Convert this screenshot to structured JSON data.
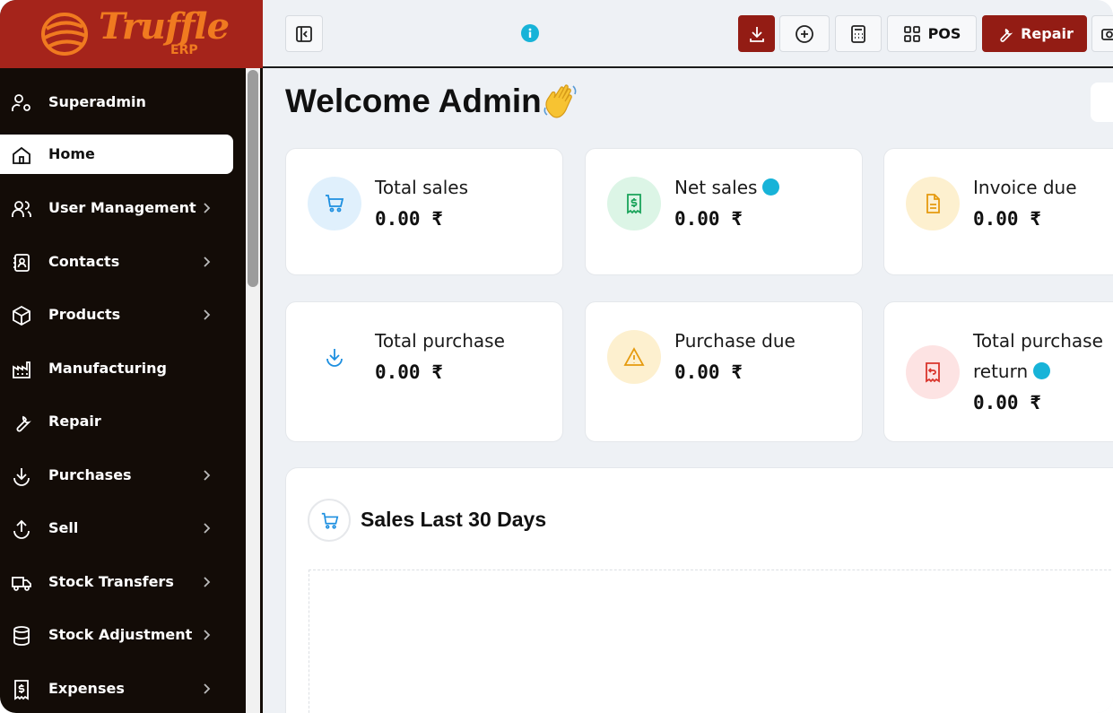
{
  "brand": {
    "name": "Truffle",
    "sub": "ERP",
    "logo_color": "#f07a20",
    "bar_color": "#a5241b"
  },
  "sidebar": {
    "items": [
      {
        "label": "Superadmin",
        "icon": "user-cog-icon",
        "has_children": false,
        "active": false
      },
      {
        "label": "Home",
        "icon": "home-icon",
        "has_children": false,
        "active": true
      },
      {
        "label": "User Management",
        "icon": "users-icon",
        "has_children": true,
        "active": false
      },
      {
        "label": "Contacts",
        "icon": "address-book-icon",
        "has_children": true,
        "active": false
      },
      {
        "label": "Products",
        "icon": "box-icon",
        "has_children": true,
        "active": false
      },
      {
        "label": "Manufacturing",
        "icon": "factory-icon",
        "has_children": false,
        "active": false
      },
      {
        "label": "Repair",
        "icon": "wrench-icon",
        "has_children": false,
        "active": false
      },
      {
        "label": "Purchases",
        "icon": "arrow-down-circle-icon",
        "has_children": true,
        "active": false
      },
      {
        "label": "Sell",
        "icon": "arrow-up-circle-icon",
        "has_children": true,
        "active": false
      },
      {
        "label": "Stock Transfers",
        "icon": "truck-icon",
        "has_children": true,
        "active": false
      },
      {
        "label": "Stock Adjustment",
        "icon": "database-icon",
        "has_children": true,
        "active": false
      },
      {
        "label": "Expenses",
        "icon": "receipt-dollar-icon",
        "has_children": true,
        "active": false
      }
    ]
  },
  "topbar": {
    "pos_label": "POS",
    "repair_label": "Repair",
    "accent": "#931c14",
    "info_color": "#17b3d8"
  },
  "main": {
    "title": "Welcome Admin",
    "cards": [
      {
        "label": "Total sales",
        "value": "0.00 ₹",
        "icon": "cart-icon",
        "has_info": false
      },
      {
        "label": "Net sales",
        "value": "0.00 ₹",
        "icon": "dollar-receipt-icon",
        "has_info": true
      },
      {
        "label": "Invoice due",
        "value": "0.00 ₹",
        "icon": "document-icon",
        "has_info": false
      },
      {
        "label": "Total purchase",
        "value": "0.00 ₹",
        "icon": "download-icon",
        "has_info": false
      },
      {
        "label": "Purchase due",
        "value": "0.00 ₹",
        "icon": "warning-icon",
        "has_info": false
      },
      {
        "label_line1": "Total purchase",
        "label_line2": "return",
        "value": "0.00 ₹",
        "icon": "receipt-return-icon",
        "has_info": true
      }
    ],
    "sales_panel": {
      "title": "Sales Last 30 Days",
      "icon": "cart-icon"
    }
  }
}
